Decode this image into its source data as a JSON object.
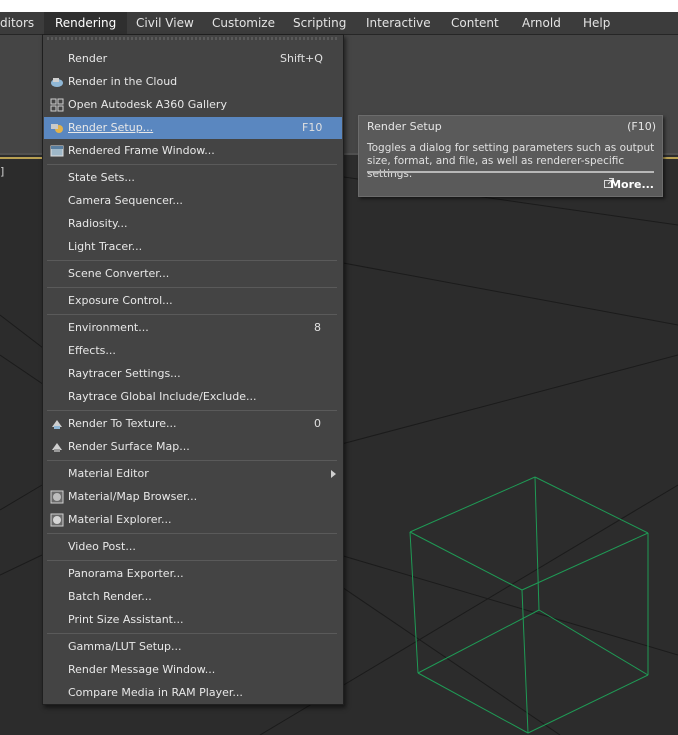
{
  "menubar": {
    "items": [
      {
        "label": "ditors",
        "name": "menu-editors"
      },
      {
        "label": "Rendering",
        "name": "menu-rendering"
      },
      {
        "label": "Civil View",
        "name": "menu-civil-view"
      },
      {
        "label": "Customize",
        "name": "menu-customize"
      },
      {
        "label": "Scripting",
        "name": "menu-scripting"
      },
      {
        "label": "Interactive",
        "name": "menu-interactive"
      },
      {
        "label": "Content",
        "name": "menu-content"
      },
      {
        "label": "Arnold",
        "name": "menu-arnold"
      },
      {
        "label": "Help",
        "name": "menu-help"
      }
    ]
  },
  "viewport": {
    "bracket_text": "]"
  },
  "menu": {
    "items": [
      {
        "label": "Render",
        "shortcut": "Shift+Q",
        "icon": "none"
      },
      {
        "label": "Render in the Cloud",
        "shortcut": "",
        "icon": "cloud-render-icon"
      },
      {
        "label": "Open Autodesk A360 Gallery",
        "shortcut": "",
        "icon": "gallery-icon"
      },
      {
        "label": "Render Setup...",
        "shortcut": "F10",
        "icon": "render-setup-icon",
        "highlighted": true
      },
      {
        "label": "Rendered Frame Window...",
        "shortcut": "",
        "icon": "frame-window-icon"
      },
      {
        "label": "State Sets...",
        "shortcut": "",
        "icon": "none"
      },
      {
        "label": "Camera Sequencer...",
        "shortcut": "",
        "icon": "none"
      },
      {
        "label": "Radiosity...",
        "shortcut": "",
        "icon": "none"
      },
      {
        "label": "Light Tracer...",
        "shortcut": "",
        "icon": "none"
      },
      {
        "label": "Scene Converter...",
        "shortcut": "",
        "icon": "none"
      },
      {
        "label": "Exposure Control...",
        "shortcut": "",
        "icon": "none"
      },
      {
        "label": "Environment...",
        "shortcut": "8",
        "icon": "none"
      },
      {
        "label": "Effects...",
        "shortcut": "",
        "icon": "none"
      },
      {
        "label": "Raytracer Settings...",
        "shortcut": "",
        "icon": "none"
      },
      {
        "label": "Raytrace Global Include/Exclude...",
        "shortcut": "",
        "icon": "none"
      },
      {
        "label": "Render To Texture...",
        "shortcut": "0",
        "icon": "render-to-texture-icon"
      },
      {
        "label": "Render Surface Map...",
        "shortcut": "",
        "icon": "surface-map-icon"
      },
      {
        "label": "Material Editor",
        "shortcut": "",
        "icon": "none",
        "submenu": true
      },
      {
        "label": "Material/Map Browser...",
        "shortcut": "",
        "icon": "material-browser-icon"
      },
      {
        "label": "Material Explorer...",
        "shortcut": "",
        "icon": "material-explorer-icon"
      },
      {
        "label": "Video Post...",
        "shortcut": "",
        "icon": "none"
      },
      {
        "label": "Panorama Exporter...",
        "shortcut": "",
        "icon": "none"
      },
      {
        "label": "Batch Render...",
        "shortcut": "",
        "icon": "none"
      },
      {
        "label": "Print Size Assistant...",
        "shortcut": "",
        "icon": "none"
      },
      {
        "label": "Gamma/LUT Setup...",
        "shortcut": "",
        "icon": "none"
      },
      {
        "label": "Render Message Window...",
        "shortcut": "",
        "icon": "none"
      },
      {
        "label": "Compare Media in RAM Player...",
        "shortcut": "",
        "icon": "none"
      }
    ]
  },
  "tooltip": {
    "title": "Render Setup",
    "shortcut": "(F10)",
    "description": "Toggles a dialog for setting parameters such as output size, format, and file, as well as renderer-specific settings.",
    "more_label": "More..."
  },
  "colors": {
    "highlight": "#5a87c0",
    "menu_bg": "#444444",
    "wireframe": "#1f9a55",
    "accent_line": "#b8a052"
  }
}
